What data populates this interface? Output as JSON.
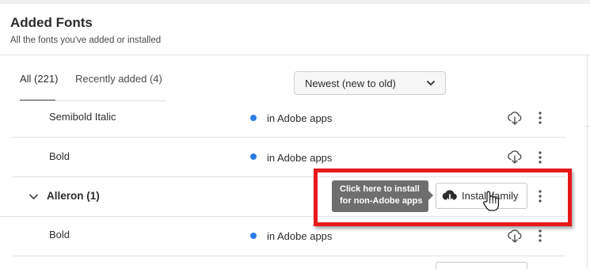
{
  "header": {
    "title": "Added Fonts",
    "subtitle": "All the fonts you've added or installed"
  },
  "tabs": [
    {
      "label": "All (221)",
      "active": true
    },
    {
      "label": "Recently added (4)",
      "active": false
    }
  ],
  "sort": {
    "selected": "Newest (new to old)",
    "icon": "chevron-down-icon"
  },
  "rows": [
    {
      "type": "style",
      "name": "Semibold Italic",
      "status": "in Adobe apps"
    },
    {
      "type": "style",
      "name": "Bold",
      "status": "in Adobe apps"
    },
    {
      "type": "family",
      "name": "Alleron (1)"
    },
    {
      "type": "style",
      "name": "Bold",
      "status": "in Adobe apps"
    }
  ],
  "family_actions": {
    "install_label": "Install family",
    "tooltip_line1": "Click here to install",
    "tooltip_line2": "for non-Adobe apps"
  },
  "colors": {
    "status_dot": "#2d7be5",
    "highlight": "#e8191a",
    "tooltip_bg": "#6e6e6e"
  }
}
